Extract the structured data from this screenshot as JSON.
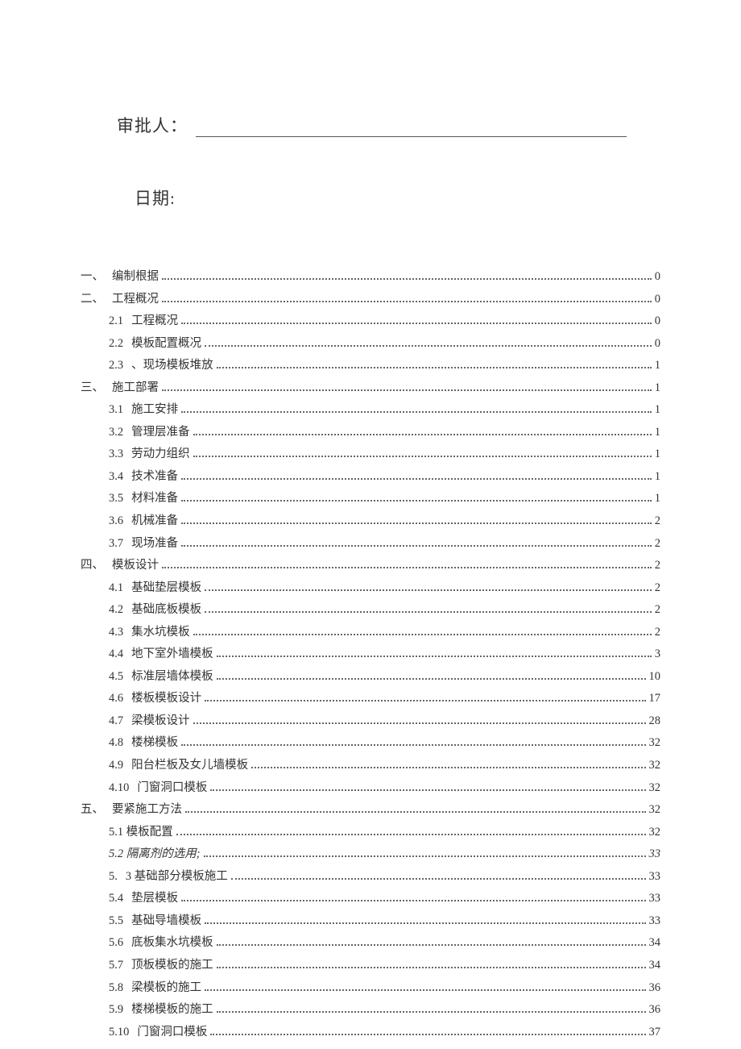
{
  "header": {
    "approver_label": "审批人：",
    "date_label": "日期:"
  },
  "toc": [
    {
      "lvl": 1,
      "num": "一、",
      "title": "编制根据",
      "page": "0"
    },
    {
      "lvl": 1,
      "num": "二、",
      "title": "工程概况",
      "page": "0"
    },
    {
      "lvl": 2,
      "num": "2.1",
      "title": "工程概况",
      "page": "0"
    },
    {
      "lvl": 2,
      "num": "2.2",
      "title": "模板配置概况",
      "page": "0"
    },
    {
      "lvl": 2,
      "num": "2.3",
      "title": "、现场模板堆放",
      "page": "1"
    },
    {
      "lvl": 1,
      "num": "三、",
      "title": "施工部署",
      "page": "1"
    },
    {
      "lvl": 2,
      "num": "3.1",
      "title": "施工安排",
      "page": "1"
    },
    {
      "lvl": 2,
      "num": "3.2",
      "title": "管理层准备",
      "page": "1"
    },
    {
      "lvl": 2,
      "num": "3.3",
      "title": "劳动力组织",
      "page": "1"
    },
    {
      "lvl": 2,
      "num": "3.4",
      "title": "技术准备",
      "page": "1"
    },
    {
      "lvl": 2,
      "num": "3.5",
      "title": "材料准备",
      "page": "1"
    },
    {
      "lvl": 2,
      "num": "3.6",
      "title": "机械准备",
      "page": "2"
    },
    {
      "lvl": 2,
      "num": "3.7",
      "title": "现场准备",
      "page": "2"
    },
    {
      "lvl": 1,
      "num": "四、",
      "title": "模板设计",
      "page": "2"
    },
    {
      "lvl": 2,
      "num": "4.1",
      "title": "基础垫层模板",
      "page": "2"
    },
    {
      "lvl": 2,
      "num": "4.2",
      "title": "基础底板模板",
      "page": "2"
    },
    {
      "lvl": 2,
      "num": "4.3",
      "title": "集水坑模板",
      "page": "2"
    },
    {
      "lvl": 2,
      "num": "4.4",
      "title": "地下室外墙模板",
      "page": "3"
    },
    {
      "lvl": 2,
      "num": "4.5",
      "title": "标准层墙体模板",
      "page": "10"
    },
    {
      "lvl": 2,
      "num": "4.6",
      "title": "楼板模板设计",
      "page": "17"
    },
    {
      "lvl": 2,
      "num": "4.7",
      "title": "梁模板设计",
      "page": "28"
    },
    {
      "lvl": 2,
      "num": "4.8",
      "title": "楼梯模板",
      "page": "32"
    },
    {
      "lvl": 2,
      "num": "4.9",
      "title": "阳台栏板及女儿墙模板",
      "page": "32"
    },
    {
      "lvl": 2,
      "num": "4.10",
      "title": "门窗洞口模板",
      "page": "32"
    },
    {
      "lvl": 1,
      "num": "五、",
      "title": "要紧施工方法",
      "page": "32"
    },
    {
      "lvl": 2,
      "num": "",
      "title": "5.1 模板配置",
      "page": "32"
    },
    {
      "lvl": 2,
      "num": "",
      "title": "5.2 隔离剂的选用;",
      "page": "33",
      "italic": true
    },
    {
      "lvl": 2,
      "num": "5.",
      "title": "3 基础部分模板施工",
      "page": "33"
    },
    {
      "lvl": 2,
      "num": "5.4",
      "title": "垫层模板",
      "page": "33"
    },
    {
      "lvl": 2,
      "num": "5.5",
      "title": "基础导墙模板",
      "page": "33"
    },
    {
      "lvl": 2,
      "num": "5.6",
      "title": "底板集水坑模板",
      "page": "34"
    },
    {
      "lvl": 2,
      "num": "5.7",
      "title": "顶板模板的施工",
      "page": "34"
    },
    {
      "lvl": 2,
      "num": "5.8",
      "title": "梁模板的施工",
      "page": "36"
    },
    {
      "lvl": 2,
      "num": "5.9",
      "title": "楼梯模板的施工",
      "page": "36"
    },
    {
      "lvl": 2,
      "num": "5.10",
      "title": "门窗洞口模板",
      "page": "37"
    }
  ]
}
